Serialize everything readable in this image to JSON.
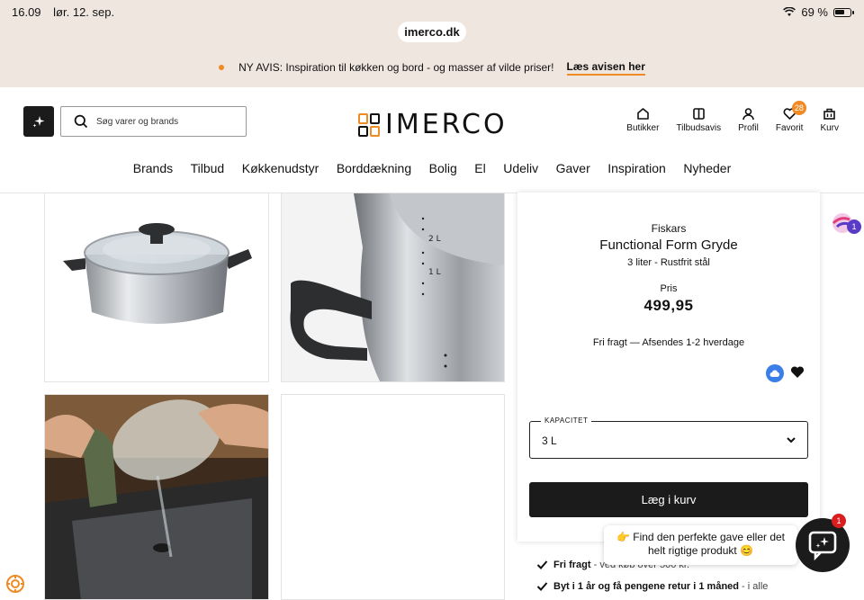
{
  "status_bar": {
    "time": "16.09",
    "date": "lør. 12. sep.",
    "battery": "69 %"
  },
  "browser": {
    "url": "imerco.dk"
  },
  "promo": {
    "text": "NY AVIS: Inspiration til køkken og bord - og masser af vilde priser!",
    "link": "Læs avisen her",
    "accent": "#f08a24"
  },
  "header": {
    "search_placeholder": "Søg varer og brands",
    "logo_text": "IMERCO",
    "icons": [
      {
        "label": "Butikker",
        "icon": "home-icon"
      },
      {
        "label": "Tilbudsavis",
        "icon": "book-icon"
      },
      {
        "label": "Profil",
        "icon": "user-icon"
      },
      {
        "label": "Favorit",
        "icon": "heart-icon",
        "badge": "28"
      },
      {
        "label": "Kurv",
        "icon": "basket-icon"
      }
    ],
    "menu": [
      "Brands",
      "Tilbud",
      "Køkkenudstyr",
      "Borddækning",
      "Bolig",
      "El",
      "Udeliv",
      "Gaver",
      "Inspiration",
      "Nyheder"
    ]
  },
  "product": {
    "brand": "Fiskars",
    "name": "Functional Form Gryde",
    "description": "3 liter - Rustfrit stål",
    "price_label": "Pris",
    "price": "499,95",
    "shipping": "Fri fragt — Afsendes 1-2 hverdage",
    "capacity_label": "KAPACITET",
    "capacity_value": "3 L",
    "add_to_cart": "Læg i kurv",
    "pot_marks": [
      "2 L",
      "1 L"
    ]
  },
  "usps": [
    {
      "bold": "Fri fragt",
      "text": " - ved køb over 500 kr.*"
    },
    {
      "bold": "Byt i 1 år og få pengene retur i 1 måned",
      "text": " - i alle"
    }
  ],
  "chat": {
    "line1": "👉 Find den perfekte gave eller det",
    "line2": "helt rigtige produkt 😊",
    "badge": "1"
  },
  "side_widget": {
    "badge": "1"
  }
}
